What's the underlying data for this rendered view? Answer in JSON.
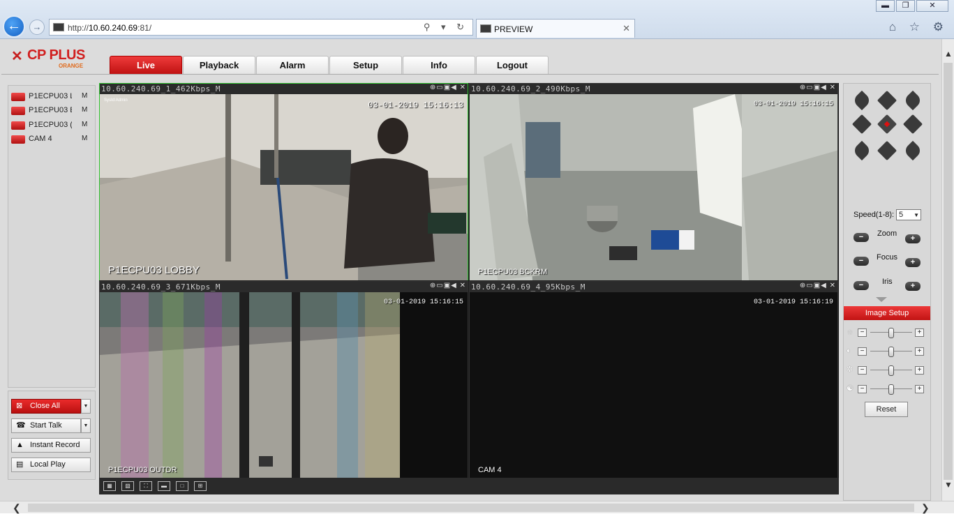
{
  "browser": {
    "url_prefix": "http://",
    "url_host": "10.60.240.69",
    "url_suffix": ":81/",
    "tab_title": "PREVIEW",
    "back_glyph": "←",
    "forward_glyph": "→",
    "tab_close": "✕",
    "addr_tools": "⚲ ▾ ↻",
    "win_minimize": "▬",
    "win_restore": "❐",
    "win_close": "✕",
    "right_icons": "⌂ ☆ ⚙"
  },
  "logo": {
    "brand": "CP PLUS",
    "sub": "ORANGE",
    "mark": "✕"
  },
  "nav": [
    {
      "label": "Live"
    },
    {
      "label": "Playback"
    },
    {
      "label": "Alarm"
    },
    {
      "label": "Setup"
    },
    {
      "label": "Info"
    },
    {
      "label": "Logout"
    }
  ],
  "cameras": [
    {
      "name": "P1ECPU03 L",
      "stream": "M"
    },
    {
      "name": "P1ECPU03 E",
      "stream": "M"
    },
    {
      "name": "P1ECPU03 (",
      "stream": "M"
    },
    {
      "name": "CAM 4",
      "stream": "M"
    }
  ],
  "left_buttons": {
    "close_all": "Close All",
    "start_talk": "Start Talk",
    "instant_record": "Instant Record",
    "local_play": "Local Play",
    "dropdown": "▼"
  },
  "panes": [
    {
      "title": "10.60.240.69_1_462Kbps_M",
      "timestamp": "03-01-2019 15:16:13",
      "label": "P1ECPU03 LOBBY"
    },
    {
      "title": "10.60.240.69_2_490Kbps_M",
      "timestamp": "03-01-2019 15:16:15",
      "label": "P1ECPU03 BCKRM"
    },
    {
      "title": "10.60.240.69_3_671Kbps_M",
      "timestamp": "03-01-2019 15:16:15",
      "label": "P1ECPU03 OUTDR"
    },
    {
      "title": "10.60.240.69_4_95Kbps_M",
      "timestamp": "03-01-2019 15:16:19",
      "label": "CAM 4"
    }
  ],
  "pane_icons": "⊕▭▣◀ ✕",
  "grid_toolbar": [
    "▦",
    "▧",
    "⛶",
    "▬",
    "□",
    "⊞"
  ],
  "ptz": {
    "speed_label": "Speed(1-8):",
    "speed_value": "5",
    "zoom_label": "Zoom",
    "focus_label": "Focus",
    "iris_label": "Iris",
    "minus": "−",
    "plus": "+"
  },
  "image_setup": {
    "title": "Image Setup",
    "reset": "Reset",
    "minus": "−",
    "plus": "+",
    "sliders": [
      {
        "icon": "brightness-icon",
        "glyph": "☼",
        "level": 0.5
      },
      {
        "icon": "contrast-icon",
        "glyph": "◐",
        "level": 0.5
      },
      {
        "icon": "saturation-icon",
        "glyph": "✲",
        "level": 0.5
      },
      {
        "icon": "hue-icon",
        "glyph": "☯",
        "level": 0.5
      }
    ]
  },
  "scroll": {
    "up": "▲",
    "down": "▼",
    "left": "❮",
    "right": "❯"
  }
}
